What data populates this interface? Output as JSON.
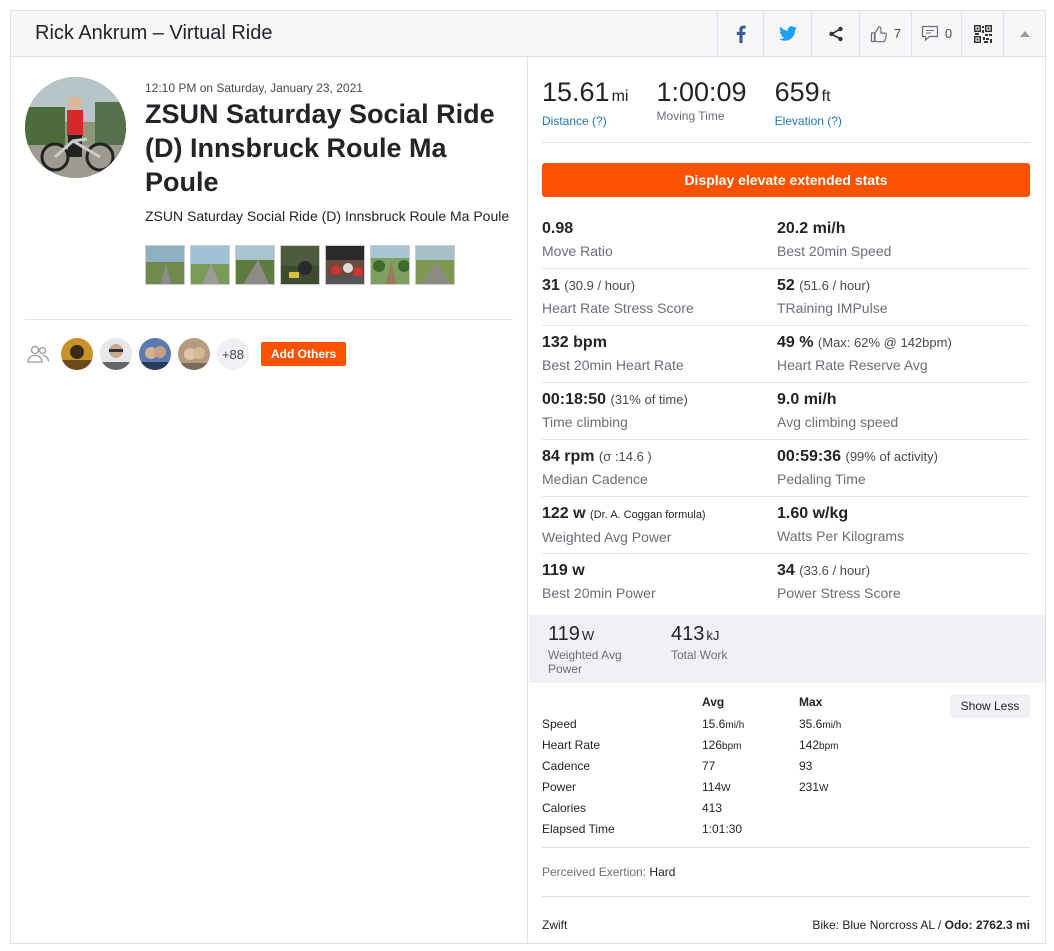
{
  "header": {
    "title": "Rick Ankrum – Virtual Ride",
    "kudos_count": "7",
    "comments_count": "0"
  },
  "activity": {
    "date": "12:10 PM on Saturday, January 23, 2021",
    "title": "ZSUN Saturday Social Ride (D) Innsbruck Roule Ma Poule",
    "description": "ZSUN Saturday Social Ride (D) Innsbruck Roule Ma Poule",
    "photos_count": 7
  },
  "athletes": {
    "more_label": "+88",
    "add_label": "Add Others"
  },
  "top_stats": [
    {
      "value": "15.61",
      "unit": "mi",
      "label": "Distance (?)",
      "link": true
    },
    {
      "value": "1:00:09",
      "unit": "",
      "label": "Moving Time",
      "link": false
    },
    {
      "value": "659",
      "unit": "ft",
      "label": "Elevation (?)",
      "link": true
    }
  ],
  "elevate_button": "Display elevate extended stats",
  "extended_stats": [
    [
      {
        "value": "0.98",
        "note": "",
        "label": "Move Ratio"
      },
      {
        "value": "20.2 mi/h",
        "note": "",
        "label": "Best 20min Speed"
      }
    ],
    [
      {
        "value": "31",
        "note": "(30.9 / hour)",
        "label": "Heart Rate Stress Score"
      },
      {
        "value": "52",
        "note": "(51.6 / hour)",
        "label": "TRaining IMPulse"
      }
    ],
    [
      {
        "value": "132 bpm",
        "note": "",
        "label": "Best 20min Heart Rate"
      },
      {
        "value": "49 %",
        "note": "(Max: 62% @ 142bpm)",
        "label": "Heart Rate Reserve Avg"
      }
    ],
    [
      {
        "value": "00:18:50",
        "note": "(31% of time)",
        "label": "Time climbing"
      },
      {
        "value": "9.0 mi/h",
        "note": "",
        "label": "Avg climbing speed"
      }
    ],
    [
      {
        "value": "84 rpm",
        "note": "(σ :14.6 )",
        "label": "Median Cadence"
      },
      {
        "value": "00:59:36",
        "note": "(99% of activity)",
        "label": "Pedaling Time"
      }
    ],
    [
      {
        "value": "122 w",
        "note": "(Dr. A. Coggan formula)",
        "label": "Weighted Avg Power",
        "small": true
      },
      {
        "value": "1.60 w/kg",
        "note": "",
        "label": "Watts Per Kilograms"
      }
    ],
    [
      {
        "value": "119 w",
        "note": "",
        "label": "Best 20min Power"
      },
      {
        "value": "34",
        "note": "(33.6 / hour)",
        "label": "Power Stress Score"
      }
    ]
  ],
  "power_band": [
    {
      "value": "119",
      "unit": "W",
      "label": "Weighted Avg Power"
    },
    {
      "value": "413",
      "unit": "kJ",
      "label": "Total Work"
    }
  ],
  "more_stats": {
    "headers": [
      "",
      "Avg",
      "Max"
    ],
    "rows": [
      {
        "label": "Speed",
        "avg": "15.6",
        "avg_unit": "mi/h",
        "max": "35.6",
        "max_unit": "mi/h"
      },
      {
        "label": "Heart Rate",
        "avg": "126",
        "avg_unit": "bpm",
        "max": "142",
        "max_unit": "bpm"
      },
      {
        "label": "Cadence",
        "avg": "77",
        "avg_unit": "",
        "max": "93",
        "max_unit": ""
      },
      {
        "label": "Power",
        "avg": "114",
        "avg_unit": "W",
        "max": "231",
        "max_unit": "W"
      },
      {
        "label": "Calories",
        "avg": "413",
        "avg_unit": "",
        "max": "",
        "max_unit": ""
      },
      {
        "label": "Elapsed Time",
        "avg": "1:01:30",
        "avg_unit": "",
        "max": "",
        "max_unit": ""
      }
    ],
    "show_less_label": "Show Less"
  },
  "exertion": {
    "label": "Perceived Exertion:",
    "value": "Hard"
  },
  "device": "Zwift",
  "bike": {
    "label": "Bike: Blue Norcross AL /",
    "odo": "Odo: 2762.3 mi"
  },
  "colors": {
    "accent": "#fc5200",
    "link": "#1e78b4"
  }
}
